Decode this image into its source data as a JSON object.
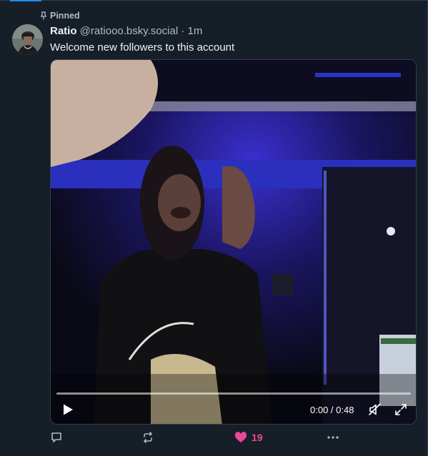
{
  "pinned": {
    "label": "Pinned",
    "icon": "pin-icon"
  },
  "post": {
    "author_name": "Ratio",
    "handle": "@ratiooo.bsky.social",
    "separator": " · ",
    "time": "1m",
    "text": "Welcome new followers to this account"
  },
  "video": {
    "current_time": "0:00",
    "duration": "0:48",
    "time_separator": " / ",
    "progress": 0,
    "icons": {
      "play": "play-icon",
      "mute": "muted-speaker-icon",
      "fullscreen": "fullscreen-icon"
    }
  },
  "actions": {
    "reply_icon": "reply-bubble-icon",
    "repost_icon": "repost-icon",
    "like_icon": "heart-icon",
    "like_count": "19",
    "more_icon": "more-dots-icon"
  },
  "colors": {
    "background": "#161e27",
    "accent": "#208bfe",
    "like": "#ec4899",
    "muted_text": "#aebbc9"
  }
}
